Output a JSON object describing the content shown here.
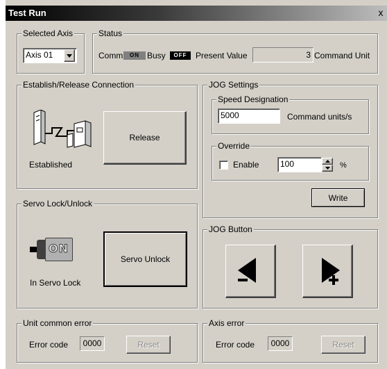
{
  "window": {
    "title": "Test Run",
    "close_glyph": "x"
  },
  "selected_axis": {
    "legend": "Selected Axis",
    "value": "Axis 01"
  },
  "status": {
    "legend": "Status",
    "comm_label": "Comm",
    "comm_lamp": "ON",
    "busy_label": "Busy",
    "busy_lamp": "OFF",
    "present_value_label": "Present Value",
    "present_value": "3",
    "unit_label": "Command Unit"
  },
  "connection": {
    "legend": "Establish/Release Connection",
    "button": "Release",
    "state": "Established",
    "icon": "connection-icon"
  },
  "servo": {
    "legend": "Servo Lock/Unlock",
    "button": "Servo Unlock",
    "state": "In Servo Lock",
    "icon_text": "ON"
  },
  "jog_settings": {
    "legend": "JOG Settings",
    "speed_legend": "Speed Designation",
    "speed_value": "5000",
    "speed_unit": "Command units/s",
    "override_legend": "Override",
    "enable_label": "Enable",
    "enable_checked": false,
    "override_value": "100",
    "override_unit": "%",
    "write_button": "Write"
  },
  "jog_button": {
    "legend": "JOG Button",
    "minus_icon": "arrow-left-minus-icon",
    "plus_icon": "arrow-right-plus-icon"
  },
  "unit_error": {
    "legend": "Unit common error",
    "code_label": "Error code",
    "code": "0000",
    "reset": "Reset"
  },
  "axis_error": {
    "legend": "Axis error",
    "code_label": "Error code",
    "code": "0000",
    "reset": "Reset"
  }
}
